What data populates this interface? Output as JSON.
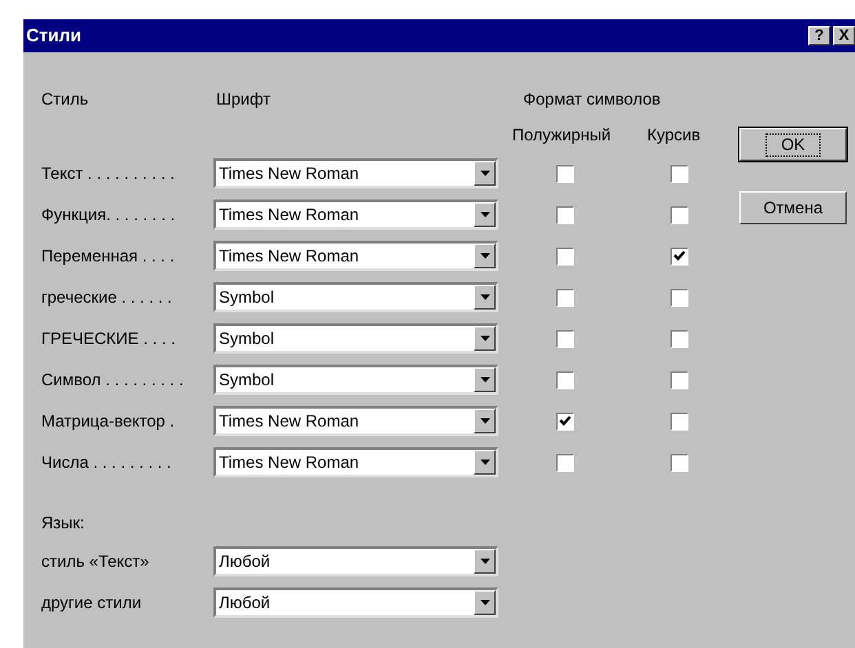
{
  "window": {
    "title": "Стили",
    "title_buttons": [
      "?",
      "X"
    ]
  },
  "headers": {
    "style": "Стиль",
    "font": "Шрифт",
    "format": "Формат символов",
    "bold": "Полужирный",
    "italic": "Курсив"
  },
  "styles": [
    {
      "label": "Текст . . . . . . . . . .",
      "font": "Times New Roman",
      "bold": false,
      "italic": false
    },
    {
      "label": "Функция. . . . . . . .",
      "font": "Times New Roman",
      "bold": false,
      "italic": false
    },
    {
      "label": "Переменная . . . .",
      "font": "Times New Roman",
      "bold": false,
      "italic": true
    },
    {
      "label": "греческие . . . . . .",
      "font": "Symbol",
      "bold": false,
      "italic": false
    },
    {
      "label": "ГРЕЧЕСКИЕ . . . .",
      "font": "Symbol",
      "bold": false,
      "italic": false
    },
    {
      "label": "Символ . . . . . . . . .",
      "font": "Symbol",
      "bold": false,
      "italic": false
    },
    {
      "label": "Матрица-вектор .",
      "font": "Times New Roman",
      "bold": true,
      "italic": false
    },
    {
      "label": "Числа . . . . . . . . .",
      "font": "Times New Roman",
      "bold": false,
      "italic": false
    }
  ],
  "language": {
    "title": "Язык:",
    "rows": [
      {
        "label": "стиль «Текст»",
        "value": "Любой"
      },
      {
        "label": "другие стили",
        "value": "Любой"
      }
    ]
  },
  "buttons": [
    {
      "label": "OK",
      "default": true
    },
    {
      "label": "Отмена",
      "default": false
    }
  ]
}
